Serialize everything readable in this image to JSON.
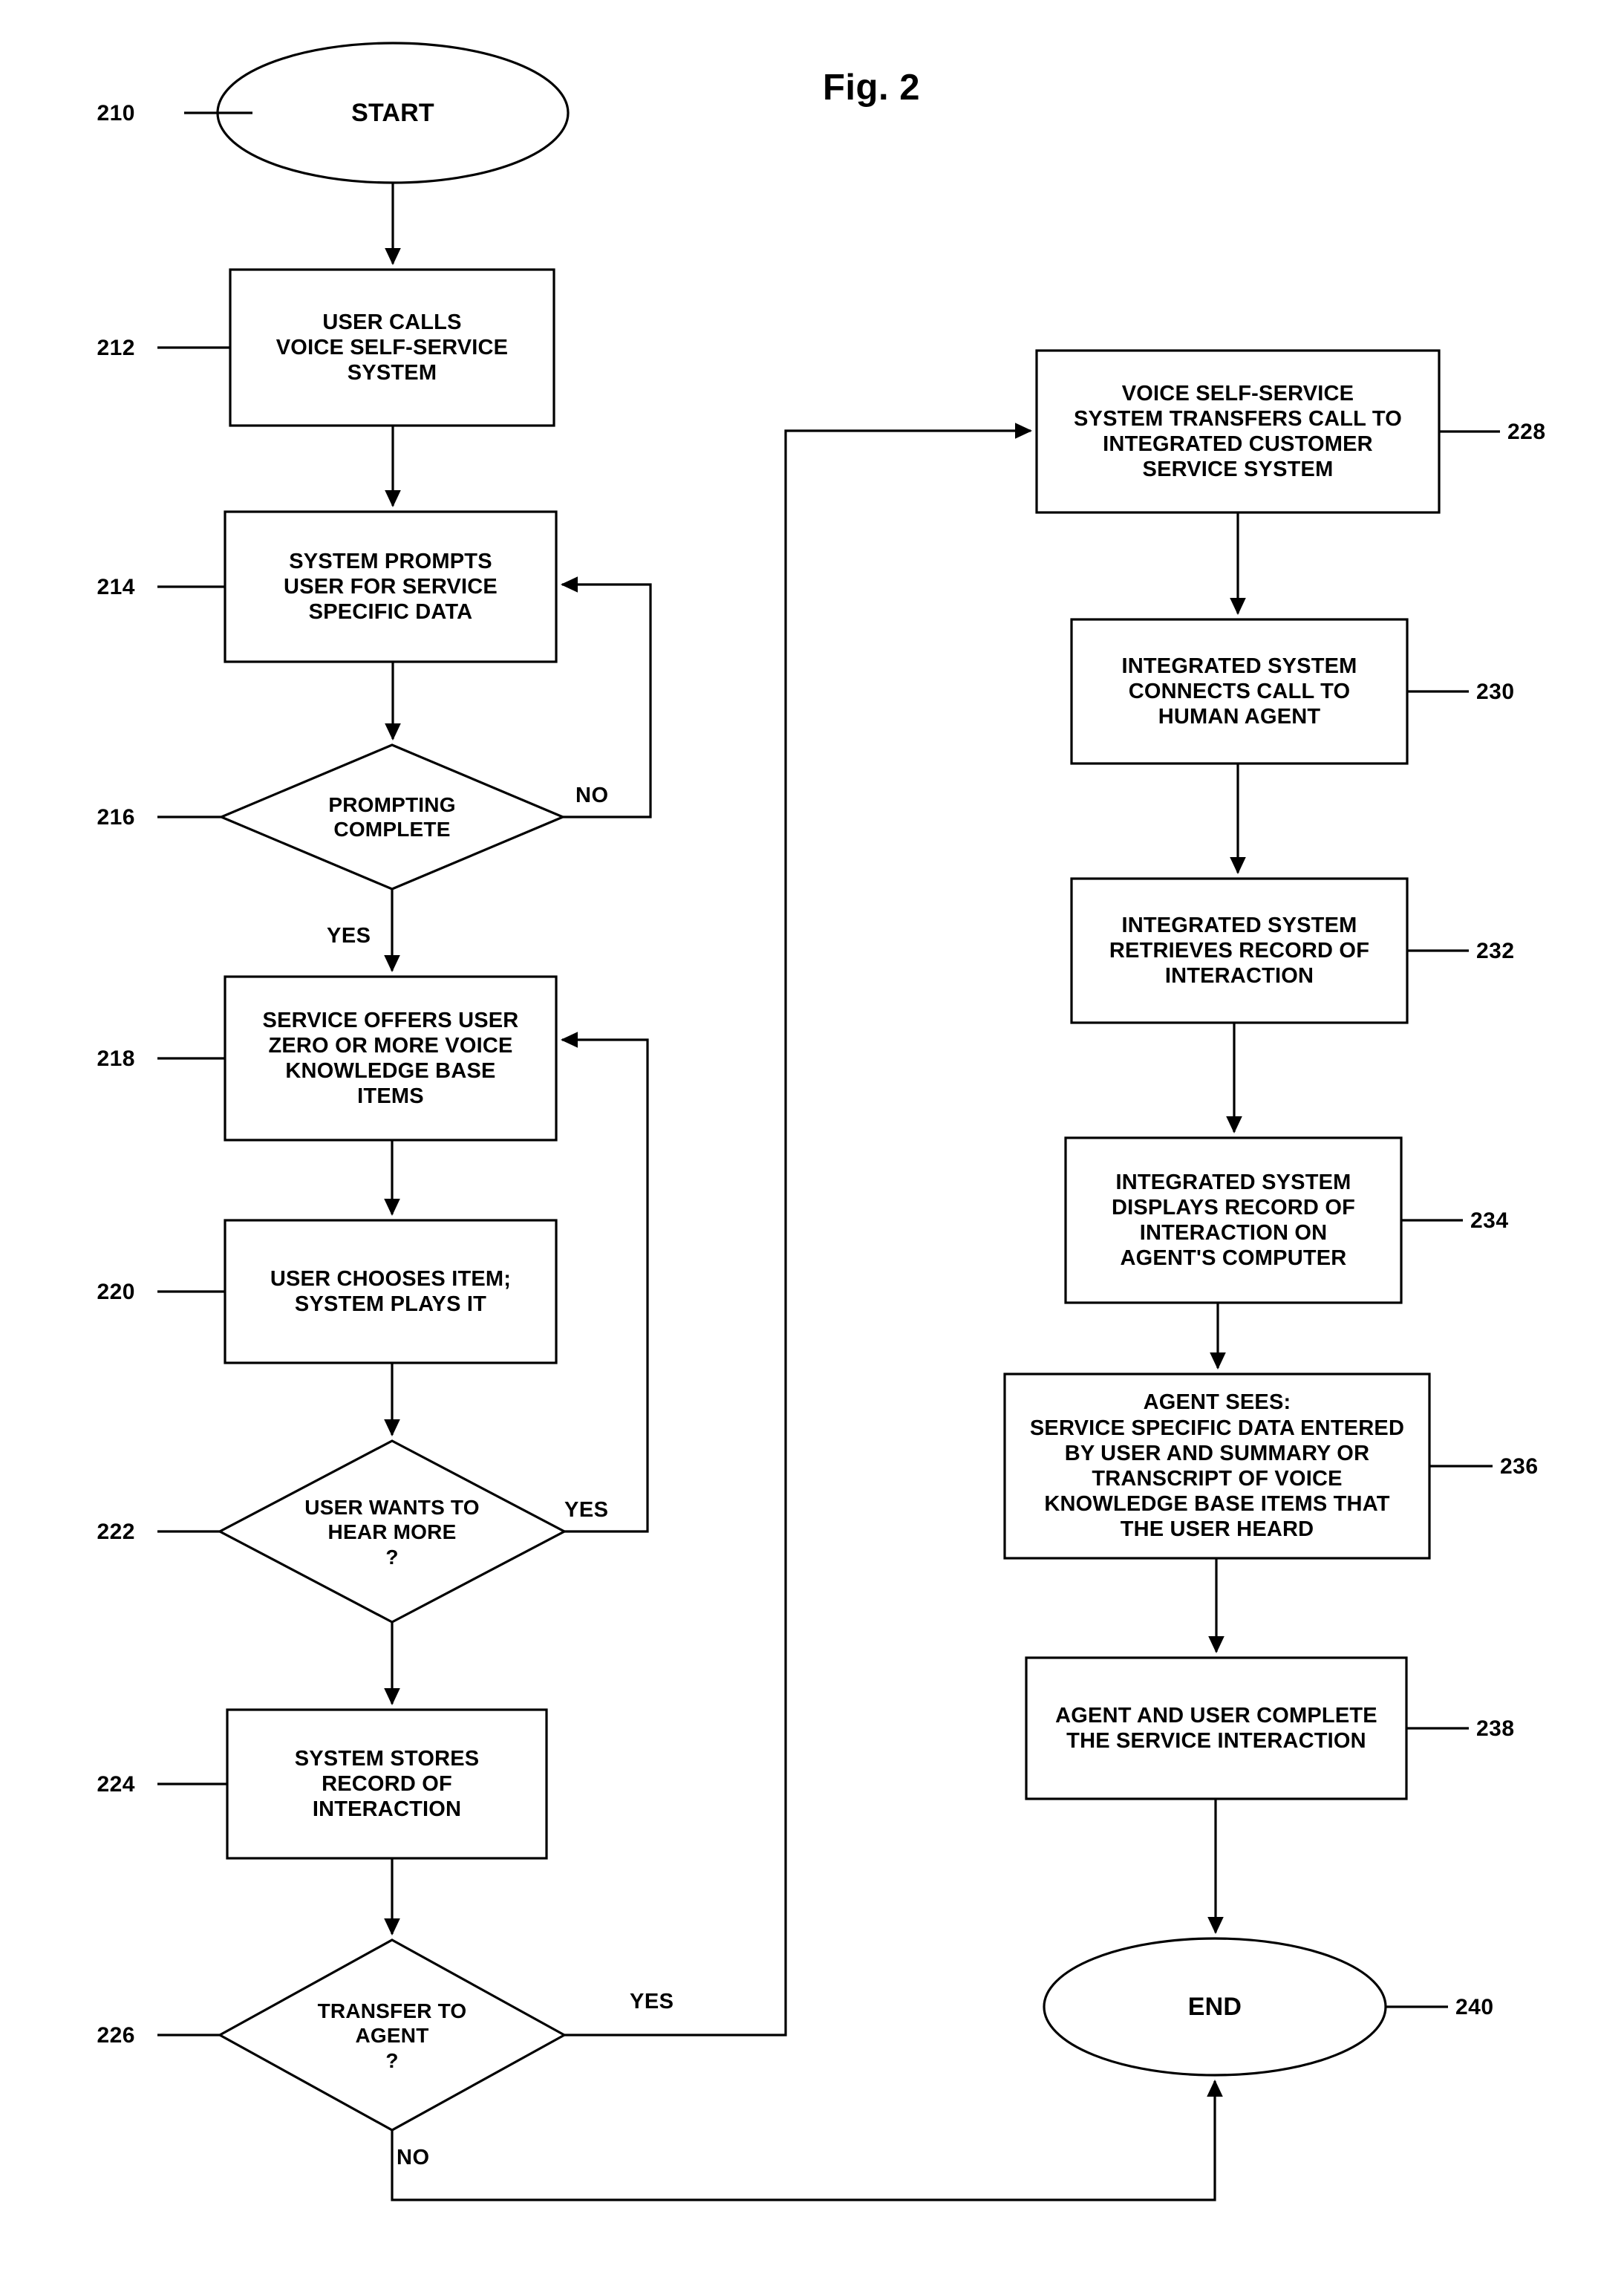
{
  "figure": {
    "title": "Fig. 2",
    "type": "flowchart"
  },
  "nodes": {
    "start": {
      "ref": "210",
      "label": "START",
      "shape": "ellipse"
    },
    "n212": {
      "ref": "212",
      "label": "USER CALLS\nVOICE SELF-SERVICE\nSYSTEM",
      "shape": "process"
    },
    "n214": {
      "ref": "214",
      "label": "SYSTEM PROMPTS\nUSER FOR  SERVICE\nSPECIFIC DATA",
      "shape": "process"
    },
    "n216": {
      "ref": "216",
      "label": "PROMPTING\nCOMPLETE",
      "shape": "decision"
    },
    "n218": {
      "ref": "218",
      "label": "SERVICE OFFERS USER\nZERO OR MORE VOICE\nKNOWLEDGE BASE\nITEMS",
      "shape": "process"
    },
    "n220": {
      "ref": "220",
      "label": "USER CHOOSES ITEM;\nSYSTEM PLAYS IT",
      "shape": "process"
    },
    "n222": {
      "ref": "222",
      "label": "USER WANTS TO\nHEAR MORE\n?",
      "shape": "decision"
    },
    "n224": {
      "ref": "224",
      "label": "SYSTEM STORES\nRECORD OF\nINTERACTION",
      "shape": "process"
    },
    "n226": {
      "ref": "226",
      "label": "TRANSFER TO\nAGENT\n?",
      "shape": "decision"
    },
    "n228": {
      "ref": "228",
      "label": "VOICE SELF-SERVICE\nSYSTEM TRANSFERS CALL TO\nINTEGRATED CUSTOMER\nSERVICE SYSTEM",
      "shape": "process"
    },
    "n230": {
      "ref": "230",
      "label": "INTEGRATED SYSTEM\nCONNECTS CALL TO\nHUMAN AGENT",
      "shape": "process"
    },
    "n232": {
      "ref": "232",
      "label": "INTEGRATED SYSTEM\nRETRIEVES RECORD OF\nINTERACTION",
      "shape": "process"
    },
    "n234": {
      "ref": "234",
      "label": "INTEGRATED SYSTEM\nDISPLAYS RECORD OF\nINTERACTION ON\nAGENT'S COMPUTER",
      "shape": "process"
    },
    "n236": {
      "ref": "236",
      "label": "AGENT SEES:\nSERVICE SPECIFIC DATA ENTERED\nBY USER AND SUMMARY OR\nTRANSCRIPT OF VOICE\nKNOWLEDGE BASE ITEMS THAT\nTHE USER HEARD",
      "shape": "process"
    },
    "n238": {
      "ref": "238",
      "label": "AGENT AND USER COMPLETE\nTHE SERVICE INTERACTION",
      "shape": "process"
    },
    "end": {
      "ref": "240",
      "label": "END",
      "shape": "ellipse"
    }
  },
  "edge_labels": {
    "e216_no": "NO",
    "e216_yes": "YES",
    "e222_yes": "YES",
    "e226_yes": "YES",
    "e226_no": "NO"
  },
  "colors": {
    "stroke": "#000000",
    "background": "#ffffff",
    "text": "#000000"
  }
}
